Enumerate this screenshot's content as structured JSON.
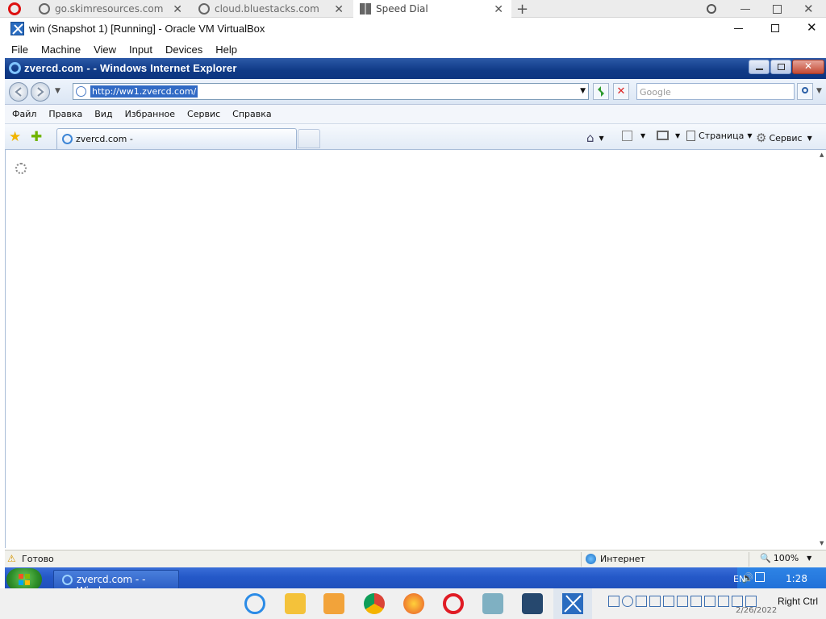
{
  "host_browser": {
    "tabs": [
      {
        "title": "go.skimresources.com"
      },
      {
        "title": "cloud.bluestacks.com"
      },
      {
        "title": "Speed Dial"
      }
    ]
  },
  "virtualbox": {
    "title": "win (Snapshot 1) [Running] - Oracle VM VirtualBox",
    "menu": [
      "File",
      "Machine",
      "View",
      "Input",
      "Devices",
      "Help"
    ]
  },
  "ie": {
    "title": "zvercd.com -  - Windows Internet Explorer",
    "url": "http://ww1.zvercd.com/",
    "search_placeholder": "Google",
    "menu": [
      "Файл",
      "Правка",
      "Вид",
      "Избранное",
      "Сервис",
      "Справка"
    ],
    "tab_title": "zvercd.com -",
    "commands": {
      "page": "Страница",
      "tools": "Сервис"
    },
    "status": {
      "text": "Готово",
      "zone": "Интернет",
      "zoom": "100%"
    }
  },
  "guest_taskbar": {
    "task_title": "zvercd.com -  - Wind...",
    "lang": "EN",
    "time": "1:28"
  },
  "host_taskbar": {
    "host_key": "Right Ctrl",
    "date": "2/26/2022"
  }
}
